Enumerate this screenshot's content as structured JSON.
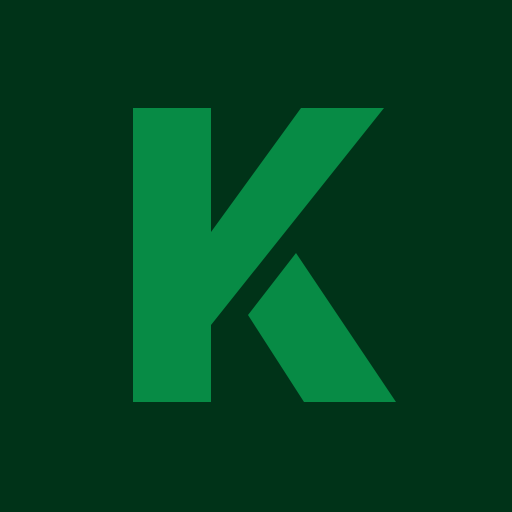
{
  "logo": {
    "letter": "K",
    "icon": "letter-k-logo-icon"
  },
  "colors": {
    "background": "#003318",
    "mark": "#078B45"
  }
}
